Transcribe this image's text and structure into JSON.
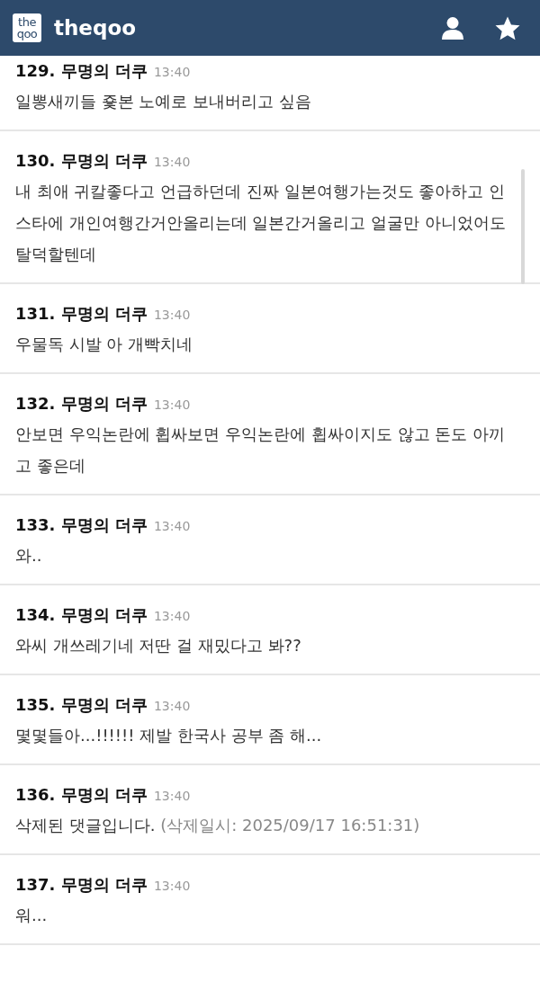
{
  "header": {
    "logo": [
      "the",
      "qoo"
    ],
    "title": "theqoo"
  },
  "comments": [
    {
      "heading": "129. 무명의 더쿠",
      "time": "13:40",
      "text": "일뽕새끼들 죷본 노예로 보내버리고 싶음"
    },
    {
      "heading": "130. 무명의 더쿠",
      "time": "13:40",
      "text": "내 최애 귀칼좋다고 언급하던데 진짜 일본여행가는것도 좋아하고 인스타에 개인여행간거안올리는데 일본간거올리고 얼굴만 아니었어도 탈덕할텐데"
    },
    {
      "heading": "131. 무명의 더쿠",
      "time": "13:40",
      "text": "우물독 시발 아 개빡치네"
    },
    {
      "heading": "132. 무명의 더쿠",
      "time": "13:40",
      "text": "안보면 우익논란에 휩싸보면 우익논란에 휩싸이지도 않고 돈도 아끼고 좋은데"
    },
    {
      "heading": "133. 무명의 더쿠",
      "time": "13:40",
      "text": "와.."
    },
    {
      "heading": "134. 무명의 더쿠",
      "time": "13:40",
      "text": "와씨 개쓰레기네 저딴 걸 재밌다고 봐??"
    },
    {
      "heading": "135. 무명의 더쿠",
      "time": "13:40",
      "text": "몇몇들아...!!!!!! 제발 한국사 공부 좀 해..."
    },
    {
      "heading": "136. 무명의 더쿠",
      "time": "13:40",
      "text": "삭제된 댓글입니다.",
      "note": "(삭제일시: 2025/09/17 16:51:31)"
    },
    {
      "heading": "137. 무명의 더쿠",
      "time": "13:40",
      "text": "워..."
    }
  ]
}
